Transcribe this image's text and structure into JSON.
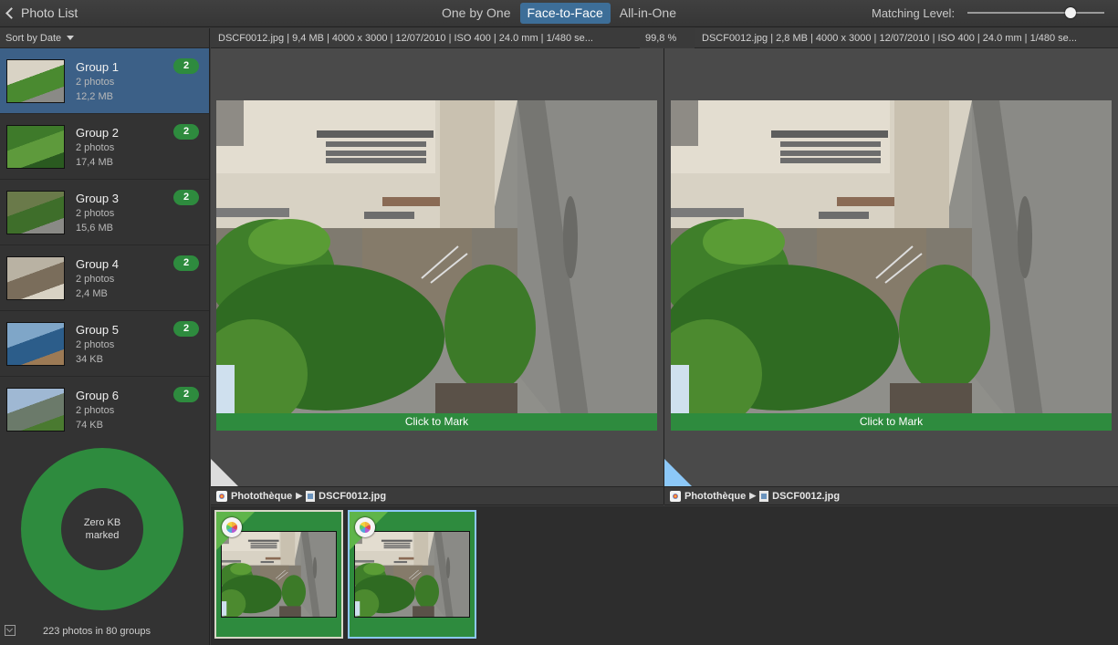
{
  "toolbar": {
    "back_label": "Photo List",
    "views": [
      {
        "label": "One by One",
        "active": false
      },
      {
        "label": "Face-to-Face",
        "active": true
      },
      {
        "label": "All-in-One",
        "active": false
      }
    ],
    "matching_label": "Matching Level:",
    "matching_level": 0.75
  },
  "sidebar": {
    "sort_label": "Sort by Date",
    "groups": [
      {
        "name": "Group 1",
        "count": "2 photos",
        "size": "12,2 MB",
        "badge": "2",
        "selected": true
      },
      {
        "name": "Group 2",
        "count": "2 photos",
        "size": "17,4 MB",
        "badge": "2",
        "selected": false
      },
      {
        "name": "Group 3",
        "count": "2 photos",
        "size": "15,6 MB",
        "badge": "2",
        "selected": false
      },
      {
        "name": "Group 4",
        "count": "2 photos",
        "size": "2,4 MB",
        "badge": "2",
        "selected": false
      },
      {
        "name": "Group 5",
        "count": "2 photos",
        "size": "34 KB",
        "badge": "2",
        "selected": false
      },
      {
        "name": "Group 6",
        "count": "2 photos",
        "size": "74 KB",
        "badge": "2",
        "selected": false
      }
    ],
    "donut_line1": "Zero KB",
    "donut_line2": "marked",
    "footer": "223 photos in 80 groups"
  },
  "left": {
    "info": "DSCF0012.jpg | 9,4 MB | 4000 x 3000 | 12/07/2010 | ISO 400 | 24.0 mm | 1/480 se...",
    "mark_label": "Click to Mark",
    "library": "Photothèque",
    "file": "DSCF0012.jpg"
  },
  "similarity": "99,8 %",
  "right": {
    "info": "DSCF0012.jpg | 2,8 MB | 4000 x 3000 | 12/07/2010 | ISO 400 | 24.0 mm | 1/480 se...",
    "mark_label": "Click to Mark",
    "library": "Photothèque",
    "file": "DSCF0012.jpg"
  },
  "colors": {
    "accent": "#3d6e98",
    "mark_green": "#2e8b3e",
    "badge_green": "#2e8b3e"
  },
  "icons": {
    "back": "chevron-left-icon",
    "sort": "triangle-down-icon",
    "library": "photos-library-icon",
    "file": "image-file-icon",
    "path_sep": "triangle-right-icon"
  }
}
